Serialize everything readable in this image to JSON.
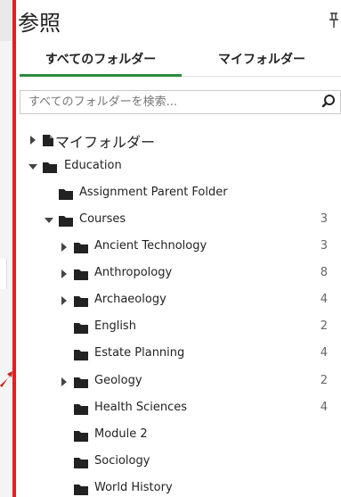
{
  "panel": {
    "title": "参照"
  },
  "tabs": [
    {
      "label": "すべてのフォルダー"
    },
    {
      "label": "マイフォルダー"
    }
  ],
  "search": {
    "placeholder": "すべてのフォルダーを検索..."
  },
  "tree": {
    "items": [
      {
        "label": "マイフォルダー",
        "count": ""
      },
      {
        "label": "Education",
        "count": ""
      },
      {
        "label": "Assignment Parent Folder",
        "count": ""
      },
      {
        "label": "Courses",
        "count": "3"
      },
      {
        "label": "Ancient Technology",
        "count": "3"
      },
      {
        "label": "Anthropology",
        "count": "8"
      },
      {
        "label": "Archaeology",
        "count": "4"
      },
      {
        "label": "English",
        "count": "2"
      },
      {
        "label": "Estate Planning",
        "count": "4"
      },
      {
        "label": "Geology",
        "count": "2"
      },
      {
        "label": "Health Sciences",
        "count": "4"
      },
      {
        "label": "Module 2",
        "count": ""
      },
      {
        "label": "Sociology",
        "count": ""
      },
      {
        "label": "World History",
        "count": ""
      }
    ]
  },
  "colors": {
    "accent_tab": "#2e8b3e",
    "red_bar": "#e02020"
  },
  "icons": [
    "pin-icon",
    "search-icon",
    "caret-right-icon",
    "caret-down-icon",
    "folder-icon",
    "user-folder-icon"
  ]
}
